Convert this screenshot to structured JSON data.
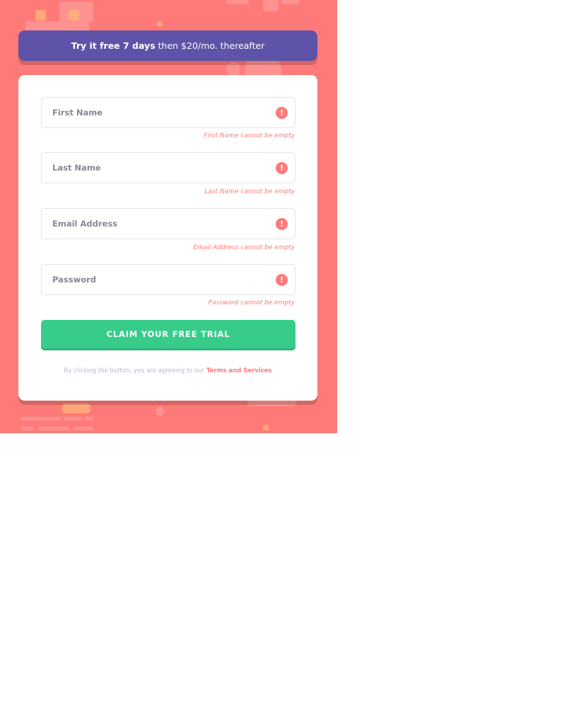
{
  "colors": {
    "background": "#fe7a78",
    "banner": "#5e53a8",
    "button": "#38cc8b",
    "error": "#fe7a78",
    "card": "#ffffff"
  },
  "banner": {
    "bold_text": "Try it free 7 days",
    "rest_text": "then $20/mo. thereafter"
  },
  "form": {
    "fields": [
      {
        "placeholder": "First Name",
        "value": "",
        "error_icon": "exclamation-icon",
        "error": "First Name cannot be empty"
      },
      {
        "placeholder": "Last Name",
        "value": "",
        "error_icon": "exclamation-icon",
        "error": "Last Name cannot be empty"
      },
      {
        "placeholder": "Email Address",
        "value": "",
        "error_icon": "exclamation-icon",
        "error": "Email Address cannot be empty"
      },
      {
        "placeholder": "Password",
        "value": "",
        "error_icon": "exclamation-icon",
        "error": "Password cannot be empty"
      }
    ],
    "error_glyph": "!",
    "submit_label": "CLAIM YOUR FREE TRIAL",
    "terms_prefix": "By clicking the button, you are agreeing to our",
    "terms_link": "Terms and Services"
  }
}
